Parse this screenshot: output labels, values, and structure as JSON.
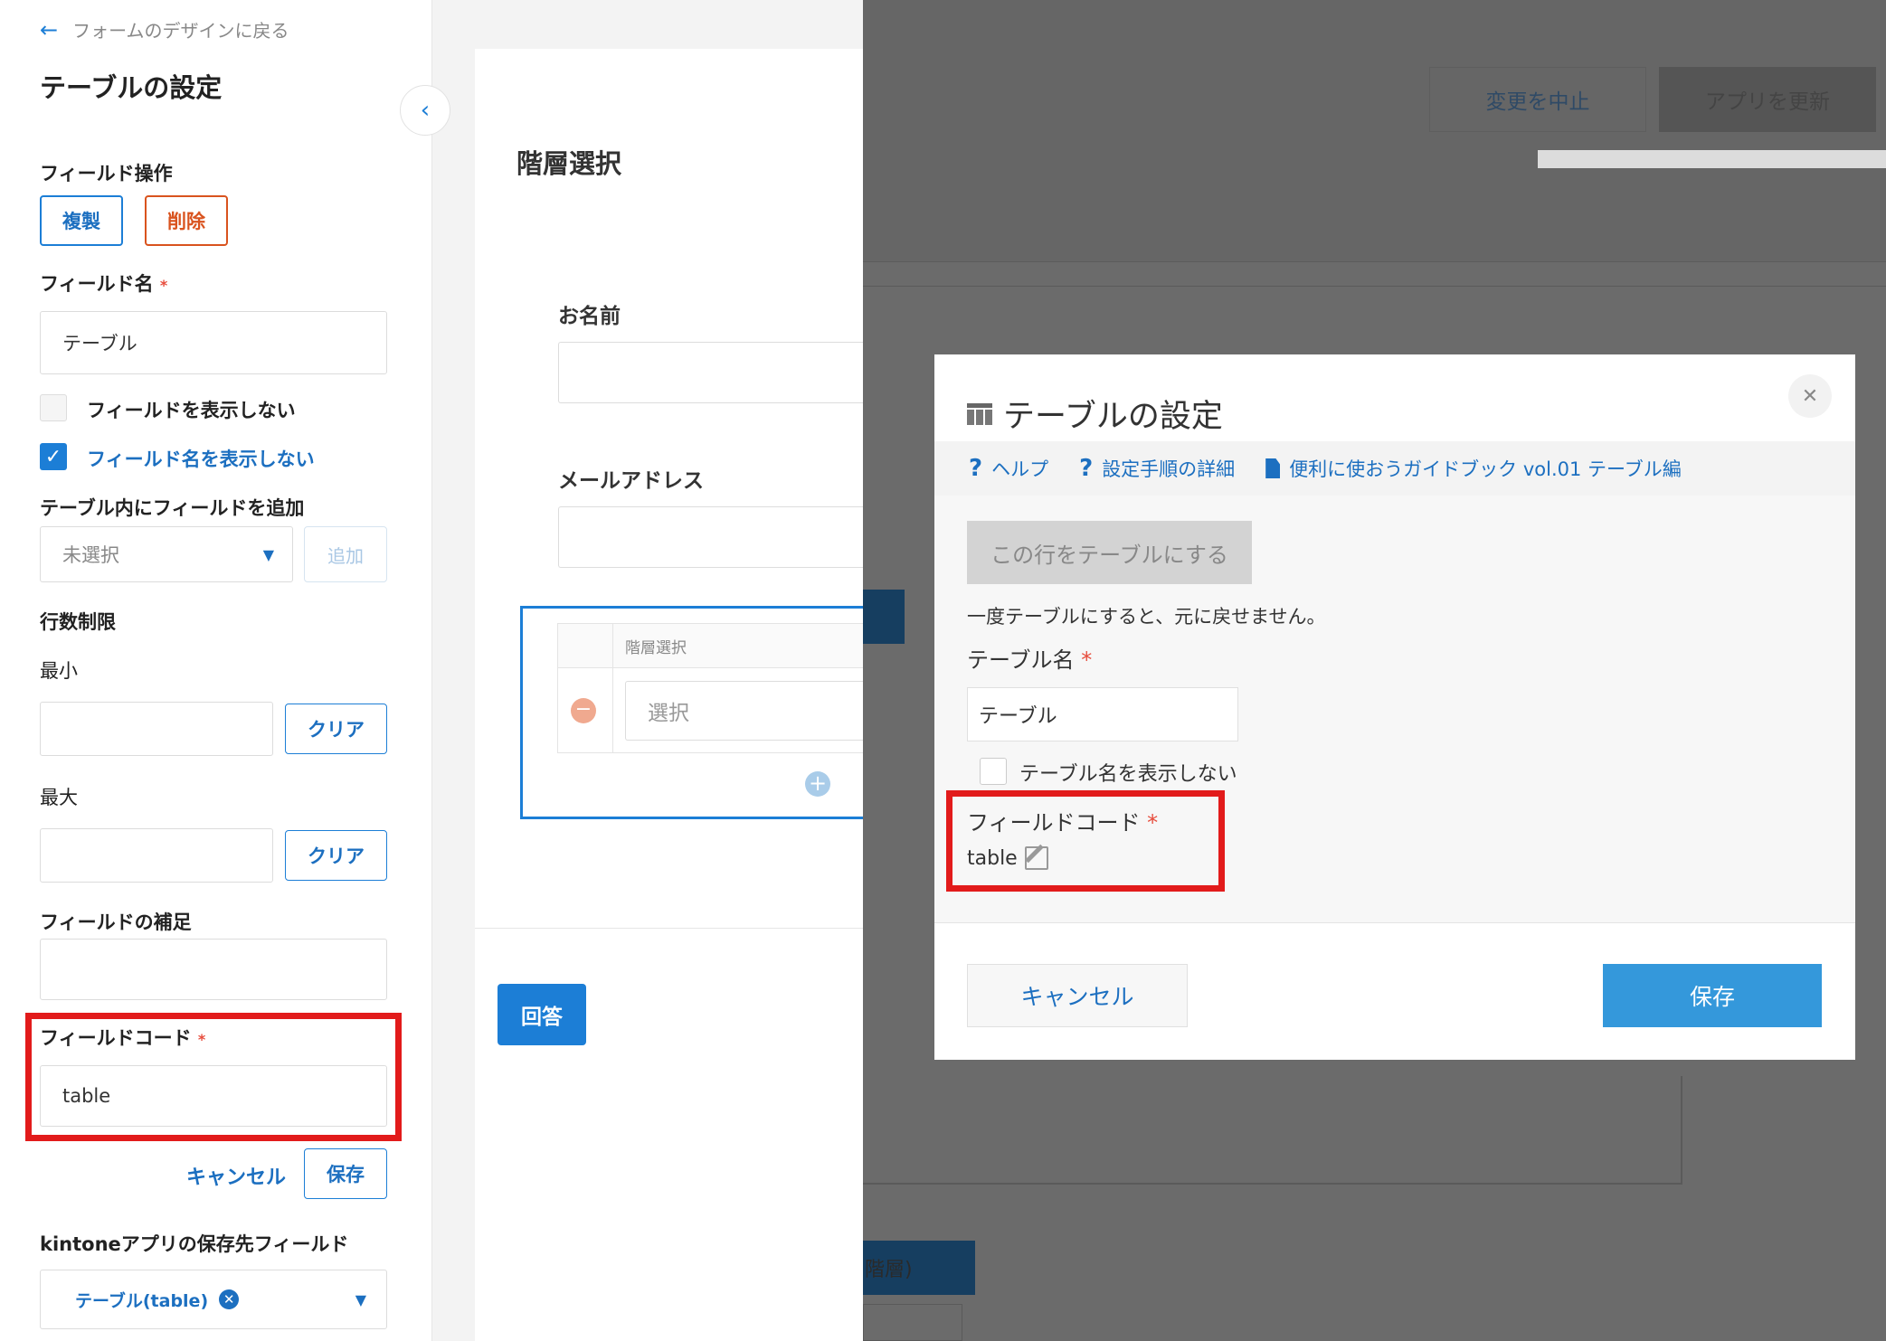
{
  "left": {
    "back_link": "フォームのデザインに戻る",
    "title": "テーブルの設定",
    "field_ops_label": "フィールド操作",
    "duplicate": "複製",
    "delete": "削除",
    "field_name_label": "フィールド名",
    "required_mark": "*",
    "field_name_value": "テーブル",
    "hide_field_label": "フィールドを表示しない",
    "hide_field_name_label": "フィールド名を表示しない",
    "add_field_label": "テーブル内にフィールドを追加",
    "add_select_value": "未選択",
    "add_button": "追加",
    "row_limit_label": "行数制限",
    "min_label": "最小",
    "max_label": "最大",
    "clear": "クリア",
    "supplement_label": "フィールドの補足",
    "field_code_label": "フィールドコード",
    "field_code_value": "table",
    "cancel": "キャンセル",
    "save": "保存",
    "kintone_label": "kintoneアプリの保存先フィールド",
    "kintone_chip": "テーブル(table)"
  },
  "preview": {
    "section_title": "階層選択",
    "name_label": "お名前",
    "email_label": "メールアドレス",
    "table_header": "階層選択",
    "select_placeholder": "選択",
    "submit_button": "回答"
  },
  "background": {
    "cancel_changes": "変更を中止",
    "update_app": "アプリを更新",
    "partial_tab": "階層)"
  },
  "modal": {
    "title": "テーブルの設定",
    "help": "ヘルプ",
    "setup_details": "設定手順の詳細",
    "guidebook": "便利に使おうガイドブック vol.01 テーブル編",
    "convert_row_button": "この行をテーブルにする",
    "convert_note": "一度テーブルにすると、元に戻せません。",
    "table_name_label": "テーブル名",
    "required_mark": "*",
    "table_name_value": "テーブル",
    "hide_table_name": "テーブル名を表示しない",
    "field_code_label": "フィールドコード",
    "field_code_value": "table",
    "cancel": "キャンセル",
    "save": "保存"
  },
  "colors": {
    "accent": "#1c7ed6",
    "danger": "#d9531e",
    "highlight": "#e21b1b",
    "modal_save": "#3498db"
  }
}
